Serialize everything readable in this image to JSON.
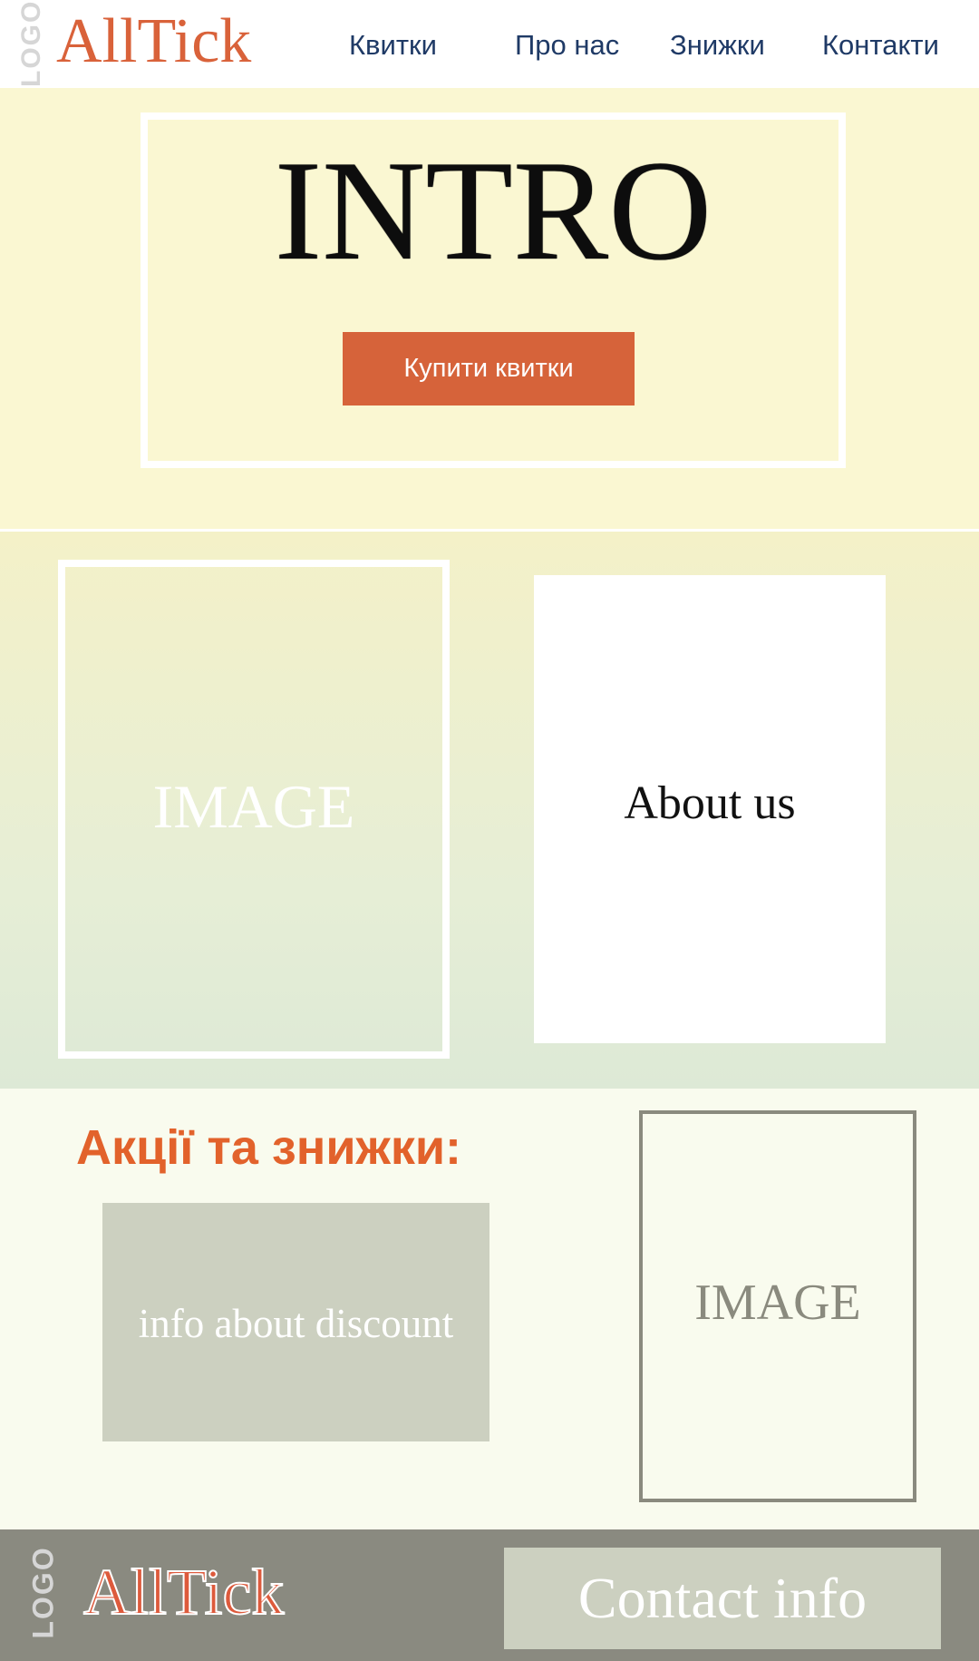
{
  "header": {
    "logo_mark": "LOGO",
    "brand": "AllTick",
    "nav": [
      {
        "label": "Квитки"
      },
      {
        "label": "Про нас"
      },
      {
        "label": "Знижки"
      },
      {
        "label": "Контакти"
      }
    ]
  },
  "intro": {
    "title": "INTRO",
    "button_label": "Купити квитки"
  },
  "about": {
    "image_label": "IMAGE",
    "card_label": "About us"
  },
  "discounts": {
    "title": "Акції та знижки:",
    "info_label": "info about discount",
    "image_label": "IMAGE"
  },
  "footer": {
    "logo_mark": "LOGO",
    "brand": "AllTick",
    "contact_label": "Contact info"
  },
  "colors": {
    "accent": "#d6633a",
    "nav_text": "#1f3a66",
    "intro_bg": "#faf7d2",
    "discount_bg": "#f9fbee",
    "footer_bg": "#8a8a80",
    "muted_box": "#ccd0c0"
  }
}
